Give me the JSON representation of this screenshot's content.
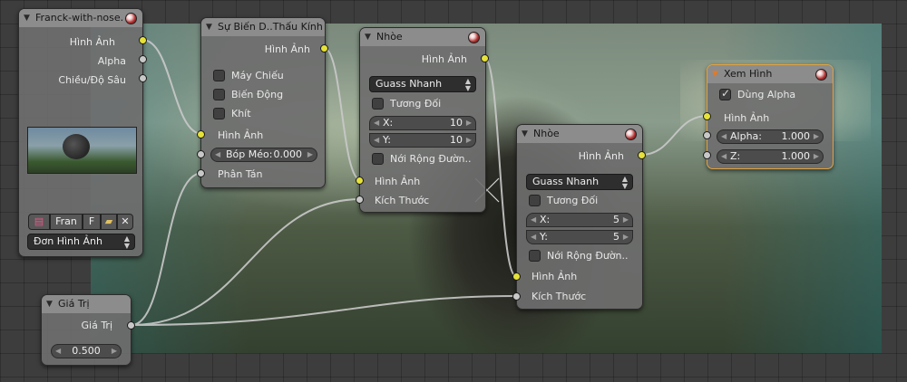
{
  "image_node": {
    "title": "Franck-with-nose.",
    "outputs": [
      "Hình Ảnh",
      "Alpha",
      "Chiều/Độ Sâu"
    ],
    "frame_label": "Fran",
    "f_label": "F",
    "source_select": "Đơn Hình Ảnh"
  },
  "lens_node": {
    "title": "Sự Biến D..Thấu Kính",
    "output": "Hình Ảnh",
    "checkboxes": [
      "Máy Chiếu",
      "Biến Động",
      "Khít"
    ],
    "input_image": "Hình Ảnh",
    "distort_label": "Bóp Méo:",
    "distort_value": "0.000",
    "dispersion": "Phân Tán"
  },
  "blur1": {
    "title": "Nhòe",
    "output": "Hình Ảnh",
    "filter": "Guass Nhanh",
    "relative_label": "Tương Đối",
    "x_label": "X:",
    "x_value": "10",
    "y_label": "Y:",
    "y_value": "10",
    "extend_label": "Nới Rộng Đườn..",
    "input_image": "Hình Ảnh",
    "input_size": "Kích Thước"
  },
  "blur2": {
    "title": "Nhòe",
    "output": "Hình Ảnh",
    "filter": "Guass Nhanh",
    "relative_label": "Tương Đối",
    "x_label": "X:",
    "x_value": "5",
    "y_label": "Y:",
    "y_value": "5",
    "extend_label": "Nới Rộng Đườn..",
    "input_image": "Hình Ảnh",
    "input_size": "Kích Thước"
  },
  "viewer_node": {
    "title": "Xem Hình",
    "use_alpha_label": "Dùng Alpha",
    "use_alpha_checked": true,
    "input_image": "Hình Ảnh",
    "alpha_label": "Alpha:",
    "alpha_value": "1.000",
    "z_label": "Z:",
    "z_value": "1.000"
  },
  "value_node": {
    "title": "Giá Trị",
    "output": "Giá Trị",
    "value": "0.500"
  },
  "colors": {
    "wire": "#c9c9c9",
    "image_socket": "#e6e23a",
    "value_socket": "#c8c8c8",
    "active_border": "#e6a23c"
  }
}
